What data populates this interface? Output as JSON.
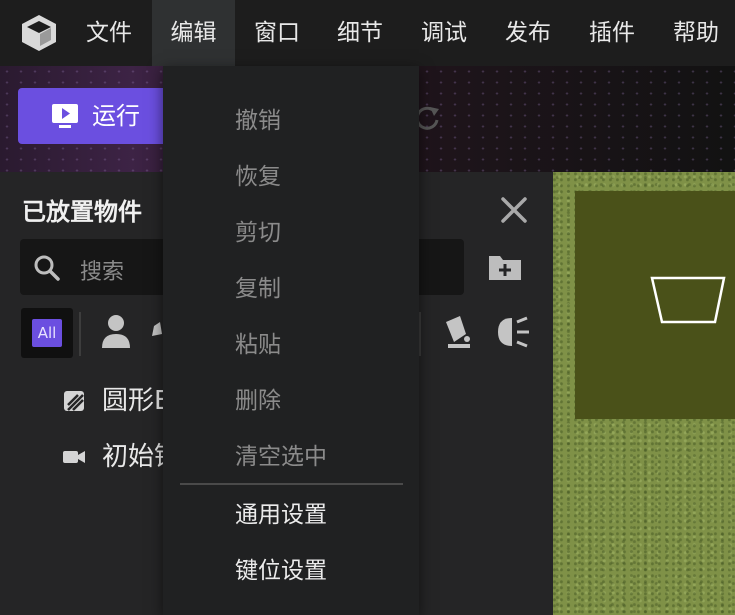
{
  "menubar": {
    "items": [
      "文件",
      "编辑",
      "窗口",
      "细节",
      "调试",
      "发布",
      "插件",
      "帮助"
    ],
    "active": "编辑"
  },
  "toolbar": {
    "run_label": "运行",
    "run_icon": "play-screen-icon",
    "redo_icon": "redo-icon"
  },
  "panel": {
    "title": "已放置物件",
    "search_placeholder": "搜索",
    "filter_all_label": "All",
    "filter_icons": [
      "person-icon",
      "npc-icon",
      "speaker-icon",
      "light-icon"
    ],
    "tree": [
      {
        "icon": "shape-icon",
        "label": "圆形B"
      },
      {
        "icon": "camera-icon",
        "label": "初始镜"
      }
    ]
  },
  "edit_menu": {
    "items": [
      {
        "label": "撤销",
        "enabled": false
      },
      {
        "label": "恢复",
        "enabled": false
      },
      {
        "label": "剪切",
        "enabled": false
      },
      {
        "label": "复制",
        "enabled": false
      },
      {
        "label": "粘贴",
        "enabled": false
      },
      {
        "label": "删除",
        "enabled": false
      },
      {
        "label": "清空选中",
        "enabled": false
      }
    ],
    "settings_items": [
      {
        "label": "通用设置",
        "enabled": true
      },
      {
        "label": "键位设置",
        "enabled": true
      }
    ]
  },
  "colors": {
    "accent": "#6b4fe0",
    "menubar_bg": "#1d1d1d",
    "panel_bg": "#252526",
    "dropdown_bg": "#202122",
    "grass": "#7f9147",
    "object_box": "#4a5119"
  }
}
